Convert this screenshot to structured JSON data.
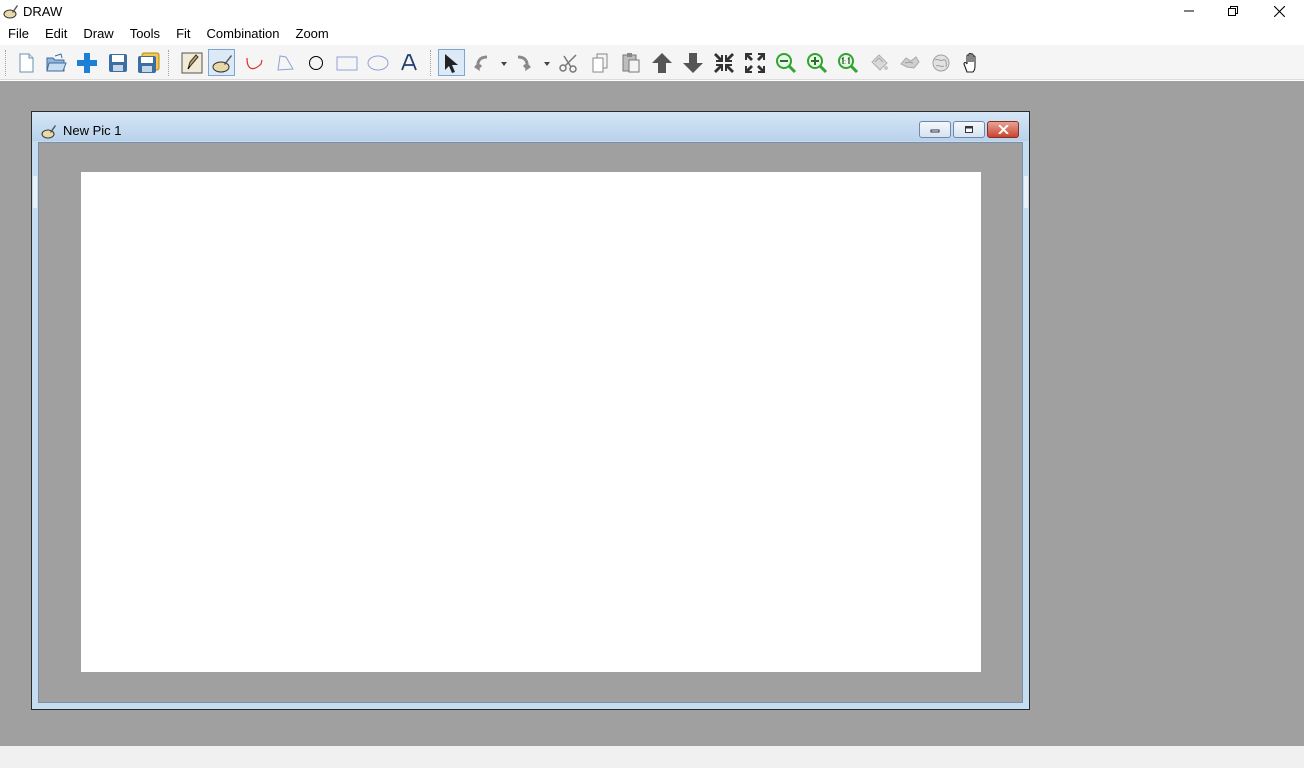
{
  "app": {
    "title": "DRAW"
  },
  "window_controls": [
    "minimize-icon",
    "restore-icon",
    "close-icon"
  ],
  "menu": [
    "File",
    "Edit",
    "Draw",
    "Tools",
    "Fit",
    "Combination",
    "Zoom"
  ],
  "toolbar": {
    "groups": [
      [
        "new-icon",
        "open-icon",
        "add-icon",
        "save-icon",
        "save-all-icon"
      ],
      [
        "pencil-icon",
        "brush-pot-icon",
        "curve-icon",
        "polygon-icon",
        "circle-icon",
        "rectangle-icon",
        "ellipse-icon",
        "text-icon"
      ],
      [
        "select-arrow-icon",
        "undo-icon",
        "redo-icon",
        "cut-icon",
        "copy-icon",
        "paste-icon",
        "bring-forward-icon",
        "send-backward-icon",
        "shrink-icon",
        "expand-icon",
        "zoom-out-icon",
        "zoom-in-icon",
        "zoom-actual-size-icon",
        "fill-icon",
        "blur-icon",
        "globe-icon",
        "pan-hand-icon"
      ]
    ],
    "active_tool": "select-arrow-icon"
  },
  "child_window": {
    "title": "New Pic 1",
    "controls": [
      "minimize-icon",
      "maximize-icon",
      "close-icon"
    ]
  },
  "colors": {
    "workspace": "#a0a0a0",
    "canvas": "#ffffff",
    "child_frame": "#c6dcf0",
    "accent_blue": "#1e7fd6",
    "zoom_green": "#2fa52f"
  }
}
